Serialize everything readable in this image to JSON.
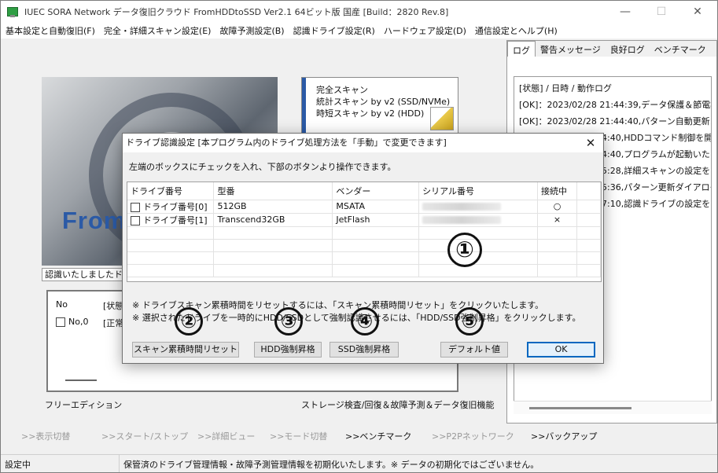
{
  "window": {
    "title": "IUEC SORA Network データ復旧クラウド FromHDDtoSSD Ver2.1 64ビット版 国産 [Build：2820 Rev.8]",
    "controls": {
      "minimize": "—",
      "maximize": "☐",
      "close": "✕"
    }
  },
  "menu": [
    "基本設定と自動復旧(F)",
    "完全・詳細スキャン設定(E)",
    "故障予測設定(B)",
    "認識ドライブ設定(R)",
    "ハードウェア設定(D)",
    "通信設定とヘルプ(H)"
  ],
  "right_panel": {
    "tabs": [
      "ログ",
      "警告メッセージ",
      "良好ログ",
      "ベンチマーク"
    ],
    "log_header": "[状態] / 日時 / 動作ログ",
    "log_lines": [
      "[OK]：2023/02/28 21:44:39,データ保護＆節電機",
      "[OK]：2023/02/28 21:44:40,パターン自動更新スレ",
      "44:40,HDDコマンド制御を開",
      "44:40,プログラムが起動いた",
      "45:28,詳細スキャンの設定を",
      "45:36,パターン更新ダイアログ",
      "47:10,認識ドライブの設定を"
    ]
  },
  "main": {
    "logo_text": "From",
    "scan_panel": {
      "line1": "完全スキャン",
      "line2": "統計スキャン by v2 (SSD/NVMe)",
      "line3": "時短スキャン by v2 (HDD)"
    },
    "recognized_label": "認識いたしましたド",
    "drive_list": {
      "col_no": "No",
      "col_status": "[状態",
      "row_no": "No,0",
      "row_status": "[正常"
    },
    "free_edition": "フリーエディション",
    "features": "ストレージ検査/回復＆故障予測＆データ復旧機能"
  },
  "nav": [
    {
      "label": ">>表示切替",
      "active": false
    },
    {
      "label": ">>スタート/ストップ",
      "active": false
    },
    {
      "label": ">>詳細ビュー",
      "active": false
    },
    {
      "label": ">>モード切替",
      "active": false
    },
    {
      "label": ">>ベンチマーク",
      "active": true
    },
    {
      "label": ">>P2Pネットワーク",
      "active": false
    },
    {
      "label": ">>バックアップ",
      "active": true
    }
  ],
  "status": {
    "left": "設定中",
    "message": "保管済のドライブ管理情報・故障予測管理情報を初期化いたします。※ データの初期化ではございません。"
  },
  "dialog": {
    "title": "ドライブ認識設定 [本プログラム内のドライブ処理方法を「手動」で変更できます]",
    "close": "✕",
    "instruction": "左端のボックスにチェックを入れ、下部のボタンより操作できます。",
    "columns": [
      "ドライブ番号",
      "型番",
      "ベンダー",
      "シリアル番号",
      "接続中"
    ],
    "rows": [
      {
        "drive": "ドライブ番号[0]",
        "model": "512GB",
        "vendor": "MSATA",
        "serial": "",
        "connected": "○"
      },
      {
        "drive": "ドライブ番号[1]",
        "model": "Transcend32GB",
        "vendor": "JetFlash",
        "serial": "",
        "connected": "×"
      }
    ],
    "note1": "※ ドライブスキャン累積時間をリセットするには、「スキャン累積時間リセット」をクリックいたします。",
    "note2": "※ 選択されたドライブを一時的にHDD/SSDとして強制認識させるには、「HDD/SSD強制昇格」をクリックします。",
    "buttons": {
      "reset": "スキャン累積時間リセット",
      "hdd": "HDD強制昇格",
      "ssd": "SSD強制昇格",
      "default": "デフォルト値",
      "ok": "OK"
    },
    "markers": [
      "①",
      "②",
      "③",
      "④",
      "⑤"
    ]
  }
}
